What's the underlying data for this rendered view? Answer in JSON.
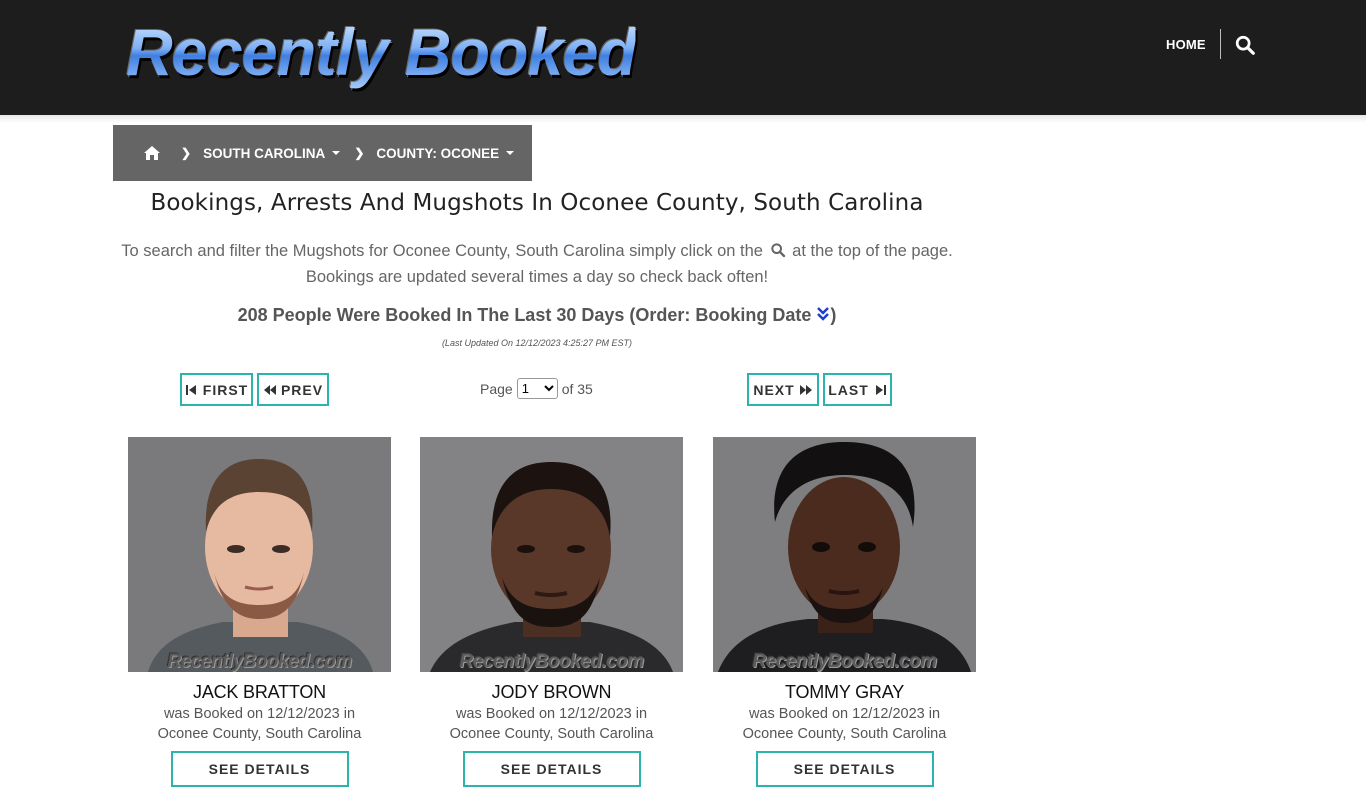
{
  "header": {
    "logo_text": "Recently Booked",
    "nav_home": "HOME",
    "search_icon": "search-icon"
  },
  "breadcrumb": {
    "home_icon": "home-icon",
    "state": "SOUTH CAROLINA",
    "county": "COUNTY: OCONEE"
  },
  "main": {
    "title": "Bookings, Arrests And Mugshots In Oconee County, South Carolina",
    "desc_line1_before": "To search and filter the Mugshots for Oconee County, South Carolina simply click on the",
    "desc_line1_after": "at the top of the page.",
    "desc_line2": "Bookings are updated several times a day so check back often!",
    "count_text": "208 People Were Booked In The Last 30 Days (Order: Booking Date",
    "count_close": ")",
    "updated": "(Last Updated On 12/12/2023 4:25:27 PM EST)"
  },
  "pagination": {
    "first": "FIRST",
    "prev": "PREV",
    "next": "NEXT",
    "last": "LAST",
    "page_label": "Page",
    "current_page": "1",
    "of_label": "of 35"
  },
  "cards": [
    {
      "name": "JACK BRATTON",
      "booked_line1": "was Booked on 12/12/2023 in",
      "booked_line2": "Oconee County, South Carolina",
      "watermark": "RecentlyBooked.com",
      "button": "SEE DETAILS"
    },
    {
      "name": "JODY BROWN",
      "booked_line1": "was Booked on 12/12/2023 in",
      "booked_line2": "Oconee County, South Carolina",
      "watermark": "RecentlyBooked.com",
      "button": "SEE DETAILS"
    },
    {
      "name": "TOMMY GRAY",
      "booked_line1": "was Booked on 12/12/2023 in",
      "booked_line2": "Oconee County, South Carolina",
      "watermark": "RecentlyBooked.com",
      "button": "SEE DETAILS"
    }
  ],
  "colors": {
    "header_bg": "#1d1d1d",
    "breadcrumb_bg": "#656565",
    "accent_border": "#2bb3ad",
    "order_icon": "#1a3fd6"
  }
}
